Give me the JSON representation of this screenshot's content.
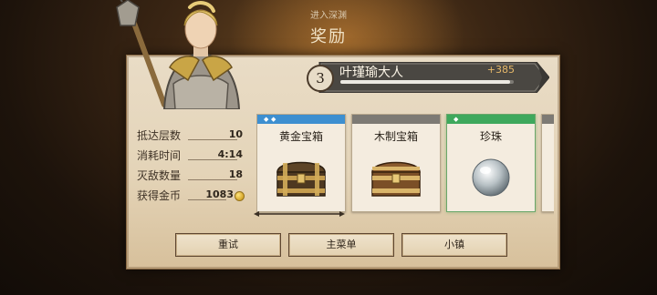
{
  "header": {
    "subtitle": "进入深渊",
    "title": "奖励"
  },
  "player": {
    "rank": "3",
    "name": "叶瑾瑜大人",
    "xp_gain": "+385",
    "xp_progress": 0.98
  },
  "stats": [
    {
      "label": "抵达层数",
      "value": "10"
    },
    {
      "label": "消耗时间",
      "value": "4:14"
    },
    {
      "label": "灭敌数量",
      "value": "18"
    },
    {
      "label": "获得金币",
      "value": "1083",
      "icon": "gold-coin-icon"
    }
  ],
  "rewards": [
    {
      "name": "黄金宝箱",
      "rarity_color": "#3d8fd0",
      "rarity_marks": 2,
      "icon": "gold-chest-icon"
    },
    {
      "name": "木制宝箱",
      "rarity_color": "#7d7a74",
      "rarity_marks": 0,
      "icon": "wooden-chest-icon"
    },
    {
      "name": "珍珠",
      "rarity_color": "#3ea85c",
      "rarity_marks": 1,
      "icon": "pearl-icon"
    }
  ],
  "buttons": {
    "retry": "重试",
    "main_menu": "主菜单",
    "town": "小镇"
  }
}
